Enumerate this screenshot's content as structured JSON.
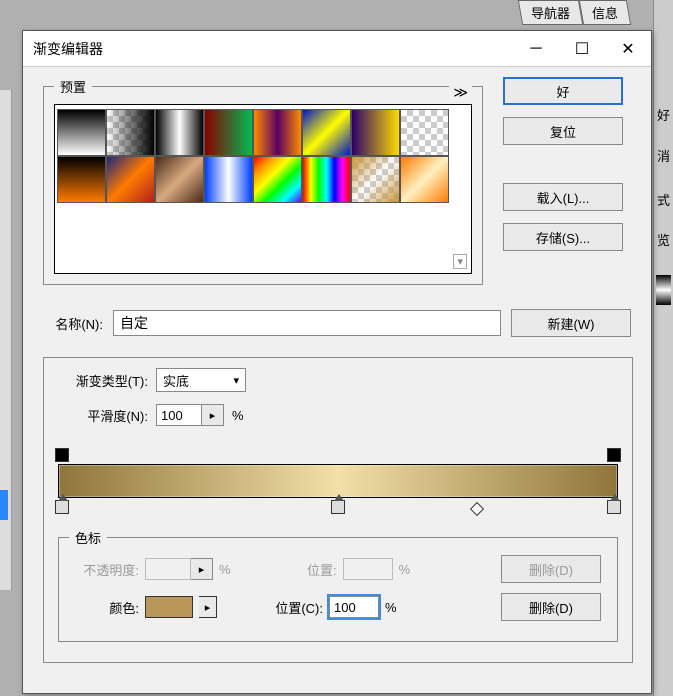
{
  "bg": {
    "tab1": "导航器",
    "tab2": "信息",
    "right": {
      "i1": "好",
      "i2": "消",
      "i3": "式",
      "i4": "览"
    }
  },
  "dialog": {
    "title": "渐变编辑器",
    "presets_legend": "预置",
    "more_symbol": "≫",
    "buttons": {
      "ok": "好",
      "reset": "复位",
      "load": "载入(L)...",
      "save": "存储(S)..."
    },
    "name_label": "名称(N):",
    "name_value": "自定",
    "new_btn": "新建(W)",
    "grad_type_label": "渐变类型(T):",
    "grad_type_value": "实底",
    "smooth_label": "平滑度(N):",
    "smooth_value": "100",
    "percent": "%",
    "stops": {
      "legend": "色标",
      "opacity_label": "不透明度:",
      "opacity_value": "",
      "pos1_label": "位置:",
      "pos1_value": "",
      "delete1": "删除(D)",
      "color_label": "颜色:",
      "pos2_label": "位置(C):",
      "pos2_value": "100",
      "delete2": "删除(D)"
    }
  },
  "chart_data": {
    "type": "gradient",
    "title": "渐变编辑器 preview bar",
    "color_stops": [
      {
        "position_pct": 0,
        "color": "#8f753a"
      },
      {
        "position_pct": 50,
        "color": "#f2e0a8"
      },
      {
        "position_pct": 100,
        "color": "#8f753a"
      }
    ],
    "midpoints_pct": [
      75
    ],
    "opacity_stops": [
      {
        "position_pct": 0,
        "opacity_pct": 100
      },
      {
        "position_pct": 100,
        "opacity_pct": 100
      }
    ],
    "selected_stop": {
      "kind": "color",
      "position_pct": 100
    }
  }
}
